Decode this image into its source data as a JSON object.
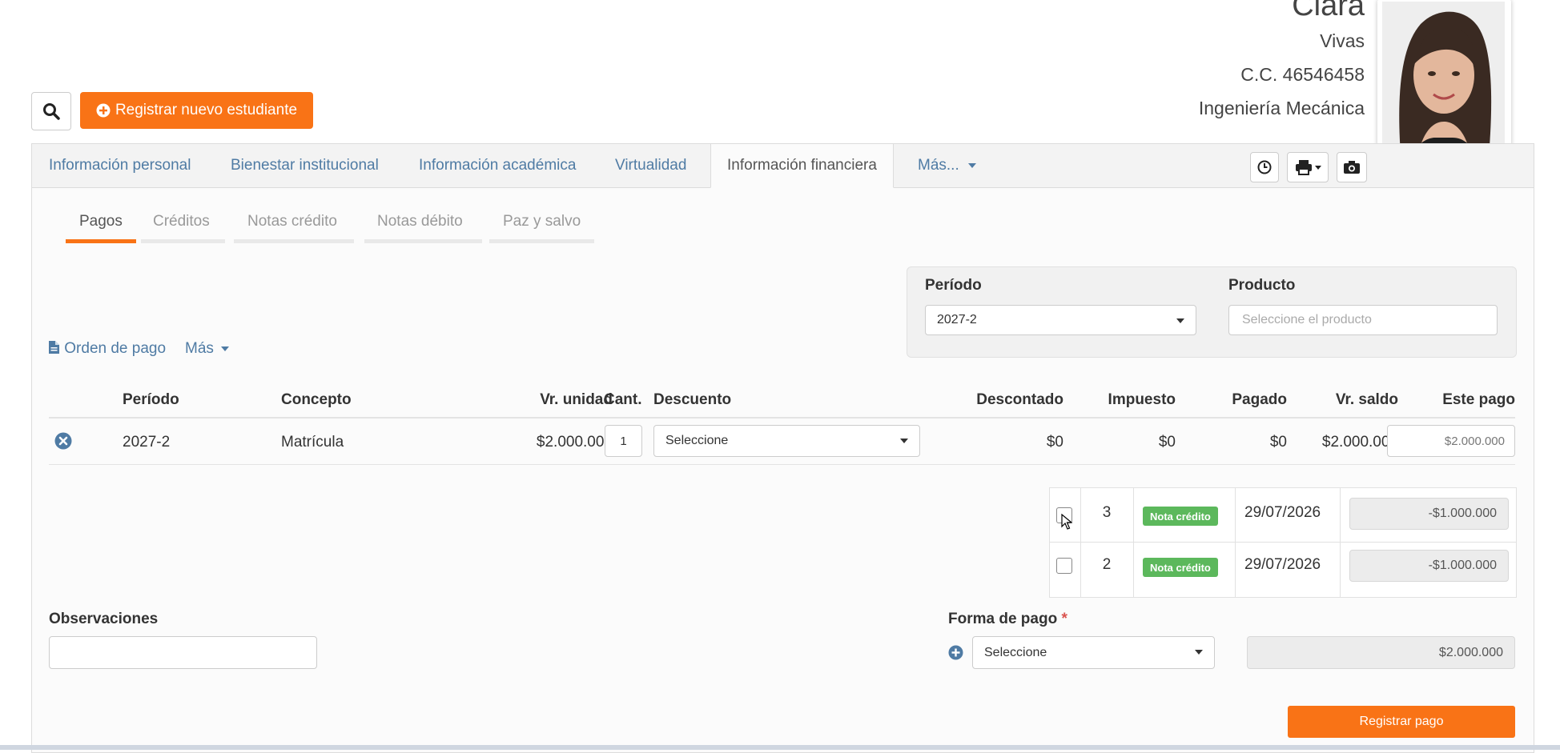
{
  "student": {
    "first_name": "Clara",
    "last_name": "Vivas",
    "document": "C.C. 46546458",
    "program": "Ingeniería Mecánica"
  },
  "toolbar": {
    "new_student_label": "Registrar nuevo estudiante"
  },
  "main_tabs": [
    {
      "label": "Información personal"
    },
    {
      "label": "Bienestar institucional"
    },
    {
      "label": "Información académica"
    },
    {
      "label": "Virtualidad"
    },
    {
      "label": "Información financiera",
      "active": true
    },
    {
      "label": "Más..."
    }
  ],
  "sub_tabs": [
    {
      "label": "Pagos",
      "active": true
    },
    {
      "label": "Créditos"
    },
    {
      "label": "Notas crédito"
    },
    {
      "label": "Notas débito"
    },
    {
      "label": "Paz y salvo"
    }
  ],
  "filters": {
    "period_label": "Período",
    "period_value": "2027-2",
    "product_label": "Producto",
    "product_placeholder": "Seleccione el producto"
  },
  "actions": {
    "payment_order": "Orden de pago",
    "more": "Más"
  },
  "table": {
    "headers": [
      "Período",
      "Concepto",
      "Vr. unidad",
      "Cant.",
      "Descuento",
      "Descontado",
      "Impuesto",
      "Pagado",
      "Vr. saldo",
      "Este pago"
    ],
    "row": {
      "period": "2027-2",
      "concept": "Matrícula",
      "unit_value": "$2.000.000",
      "quantity": "1",
      "discount": "Seleccione",
      "discounted": "$0",
      "tax": "$0",
      "paid": "$0",
      "balance": "$2.000.000",
      "this_payment": "$2.000.000"
    }
  },
  "credit_notes": [
    {
      "number": "3",
      "type": "Nota crédito",
      "date": "29/07/2026",
      "amount": "-$1.000.000"
    },
    {
      "number": "2",
      "type": "Nota crédito",
      "date": "29/07/2026",
      "amount": "-$1.000.000"
    }
  ],
  "observations": {
    "label": "Observaciones"
  },
  "payment_method": {
    "label": "Forma de pago",
    "required_mark": "*",
    "select_value": "Seleccione",
    "amount": "$2.000.000"
  },
  "submit_label": "Registrar pago",
  "colors": {
    "accent": "#f97316",
    "link": "#4f7ba4",
    "badge": "#5cb85c"
  }
}
